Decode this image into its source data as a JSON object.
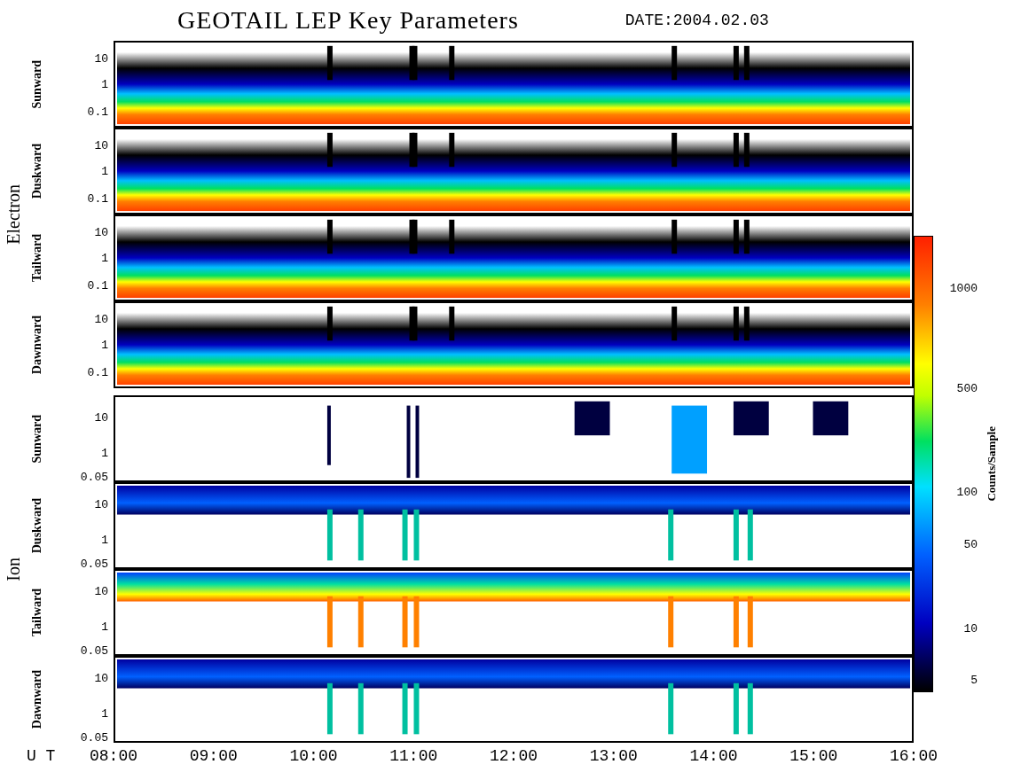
{
  "title": "GEOTAIL LEP Key Parameters",
  "date_label": "DATE:",
  "date": "2004.02.03",
  "groups": [
    {
      "label": "Electron",
      "panels": [
        {
          "label": "Sunward",
          "kind": "full",
          "yticks": [
            "10",
            "1",
            "0.1"
          ]
        },
        {
          "label": "Duskward",
          "kind": "full",
          "yticks": [
            "10",
            "1",
            "0.1"
          ]
        },
        {
          "label": "Tailward",
          "kind": "full",
          "yticks": [
            "10",
            "1",
            "0.1"
          ]
        },
        {
          "label": "Dawnward",
          "kind": "full",
          "yticks": [
            "10",
            "1",
            "0.1"
          ]
        }
      ]
    },
    {
      "label": "Ion",
      "panels": [
        {
          "label": "Sunward",
          "kind": "sparse",
          "yticks": [
            "10",
            "1",
            "0.05"
          ]
        },
        {
          "label": "Duskward",
          "kind": "band",
          "yticks": [
            "10",
            "1",
            "0.05"
          ]
        },
        {
          "label": "Tailward",
          "kind": "hot-band",
          "yticks": [
            "10",
            "1",
            "0.05"
          ]
        },
        {
          "label": "Dawnward",
          "kind": "band",
          "yticks": [
            "10",
            "1",
            "0.05"
          ]
        }
      ]
    }
  ],
  "colorbar": {
    "label": "Counts/Sample",
    "ticks": [
      "1000",
      "500",
      "100",
      "50",
      "10",
      "5"
    ]
  },
  "time_axis": {
    "label": "U T",
    "ticks": [
      "08:00",
      "09:00",
      "10:00",
      "11:00",
      "12:00",
      "13:00",
      "14:00",
      "15:00",
      "16:00"
    ]
  }
}
